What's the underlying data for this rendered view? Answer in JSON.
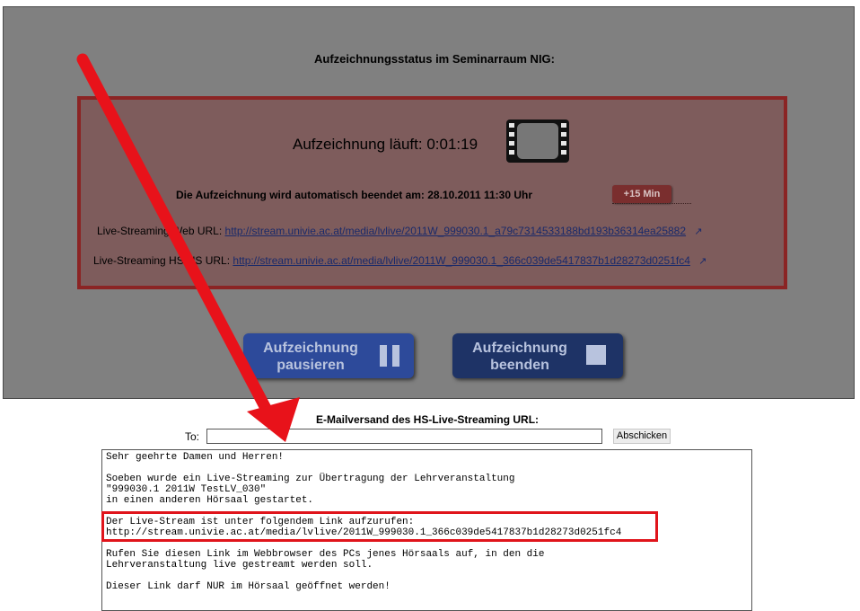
{
  "status": {
    "title": "Aufzeichnungsstatus im Seminarraum NIG:",
    "recording_line": "Aufzeichnung läuft: 0:01:19",
    "auto_end": "Die Aufzeichnung wird automatisch beendet am: 28.10.2011 11:30 Uhr",
    "extend_label": "+15 Min",
    "web_url_label": "Live-Streaming Web URL:",
    "web_url": "http://stream.univie.ac.at/media/lvlive/2011W_999030.1_a79c7314533188bd193b36314ea25882",
    "hs_url_label": "Live-Streaming HS-HS URL:",
    "hs_url": "http://stream.univie.ac.at/media/lvlive/2011W_999030.1_366c039de5417837b1d28273d0251fc4",
    "ext_icon": "external-link-icon"
  },
  "buttons": {
    "pause_line1": "Aufzeichnung",
    "pause_line2": "pausieren",
    "stop_line1": "Aufzeichnung",
    "stop_line2": "beenden"
  },
  "email": {
    "title": "E-Mailversand des HS-Live-Streaming URL:",
    "to_label": "To:",
    "to_value": "",
    "send_label": "Abschicken",
    "message": {
      "line1": "Sehr geehrte Damen und Herren!",
      "line2": "Soeben wurde ein Live-Streaming zur Übertragung der Lehrveranstaltung",
      "line3": "\"999030.1 2011W TestLV_030\"",
      "line4": "in einen anderen Hörsaal gestartet.",
      "line5": "Der Live-Stream ist unter folgendem Link aufzurufen:",
      "line6": "http://stream.univie.ac.at/media/lvlive/2011W_999030.1_366c039de5417837b1d28273d0251fc4",
      "line7": "Rufen Sie diesen Link im Webbrowser des PCs jenes Hörsaals auf, in den die",
      "line8": "Lehrveranstaltung live gestreamt werden soll.",
      "line9": "Dieser Link darf NUR im Hörsaal geöffnet werden!"
    }
  },
  "colors": {
    "panel_bg": "#808080",
    "record_border": "#8b2424",
    "highlight": "#e0141b",
    "arrow": "#e8121a"
  }
}
